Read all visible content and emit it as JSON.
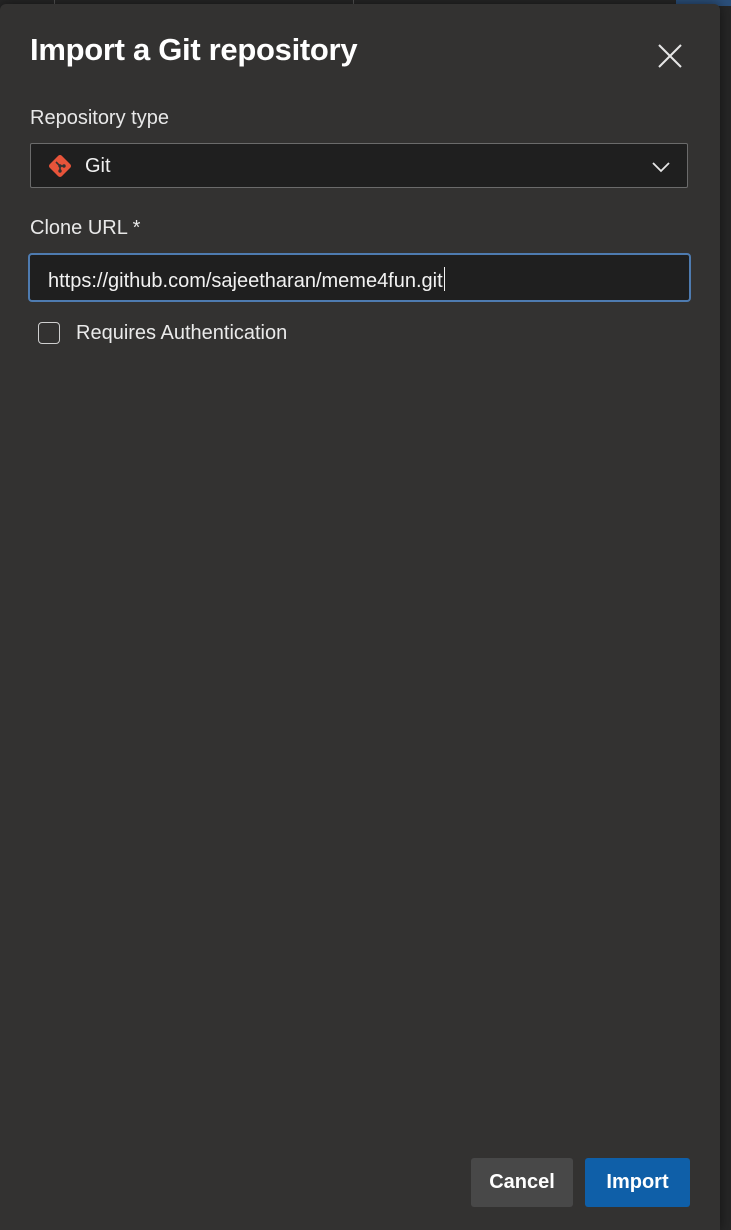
{
  "dialog": {
    "title": "Import a Git repository",
    "close_icon": "close-icon"
  },
  "repository_type": {
    "label": "Repository type",
    "value": "Git",
    "icon": "git-icon",
    "icon_color": "#e8543a"
  },
  "clone_url": {
    "label": "Clone URL *",
    "value": "https://github.com/sajeetharan/meme4fun.git"
  },
  "auth": {
    "label": "Requires Authentication",
    "checked": false
  },
  "buttons": {
    "cancel": "Cancel",
    "import": "Import"
  },
  "colors": {
    "dialog_bg": "#333231",
    "primary": "#0f5fa8",
    "focus_border": "#4e7bb0"
  }
}
